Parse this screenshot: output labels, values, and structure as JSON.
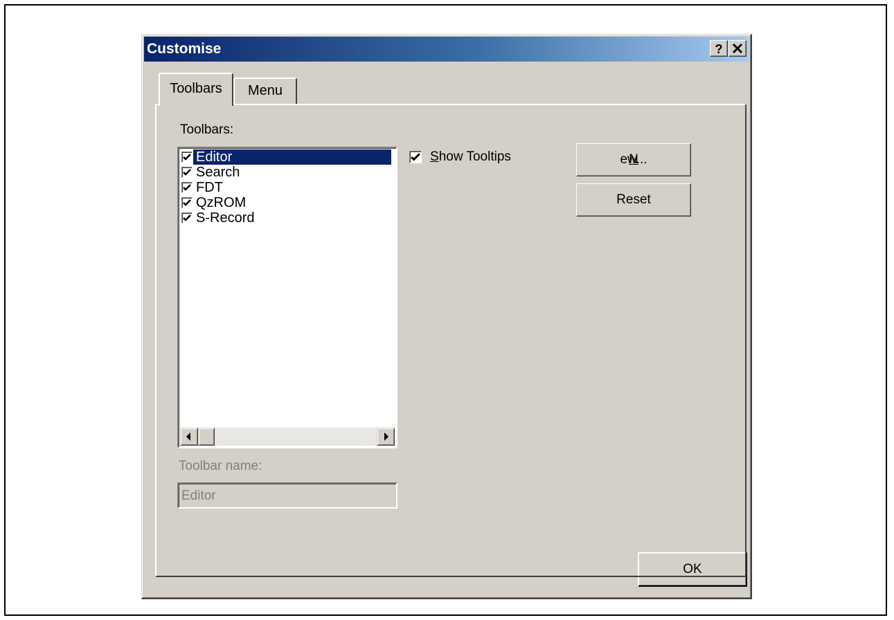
{
  "dialog": {
    "title": "Customise",
    "help_button": "?",
    "close_button": "×"
  },
  "tabs": [
    {
      "label": "Toolbars",
      "active": true
    },
    {
      "label": "Menu",
      "active": false
    }
  ],
  "toolbars_section": {
    "label": "Toolbars:",
    "items": [
      {
        "label": "Editor",
        "checked": true,
        "selected": true
      },
      {
        "label": "Search",
        "checked": true,
        "selected": false
      },
      {
        "label": "FDT",
        "checked": true,
        "selected": false
      },
      {
        "label": "QzROM",
        "checked": true,
        "selected": false
      },
      {
        "label": "S-Record",
        "checked": true,
        "selected": false
      }
    ]
  },
  "show_tooltips": {
    "mnemonic": "S",
    "rest": "how Tooltips",
    "checked": true
  },
  "buttons": {
    "new_mnemonic": "N",
    "new_rest": "ew...",
    "reset": "Reset",
    "ok": "OK"
  },
  "toolbar_name": {
    "label": "Toolbar name:",
    "value": "Editor"
  },
  "colors": {
    "face": "#d4d0c8",
    "title_start": "#0a246a",
    "title_end": "#a6caf0",
    "selection": "#0a246a"
  }
}
